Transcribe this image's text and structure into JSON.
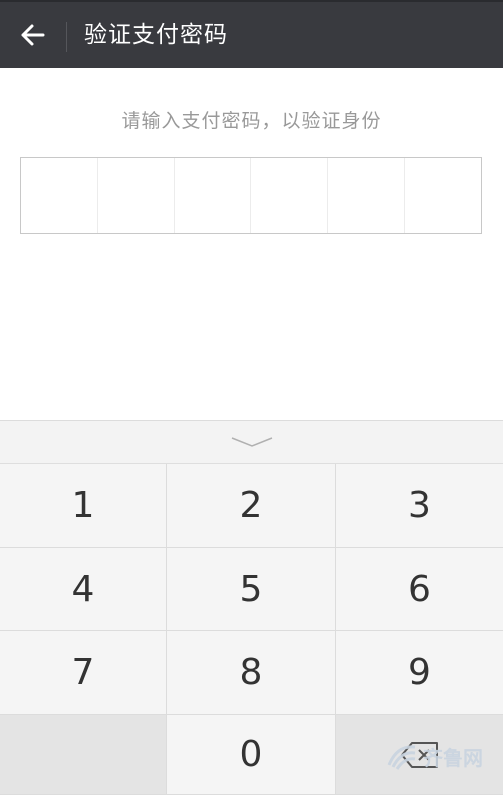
{
  "header": {
    "back_icon": "arrow-left-icon",
    "title": "验证支付密码"
  },
  "prompt": "请输入支付密码，以验证身份",
  "pin": {
    "length": 6,
    "entered": 0
  },
  "keypad": {
    "collapse_icon": "chevron-down-icon",
    "keys": [
      "1",
      "2",
      "3",
      "4",
      "5",
      "6",
      "7",
      "8",
      "9",
      "",
      "0",
      ""
    ],
    "delete_icon": "backspace-icon"
  },
  "watermark": {
    "text": "齐鲁网",
    "icon": "wave-logo-icon"
  },
  "colors": {
    "topbar": "#393a3f",
    "keypad_bg": "#f5f5f5",
    "text": "#333333"
  }
}
